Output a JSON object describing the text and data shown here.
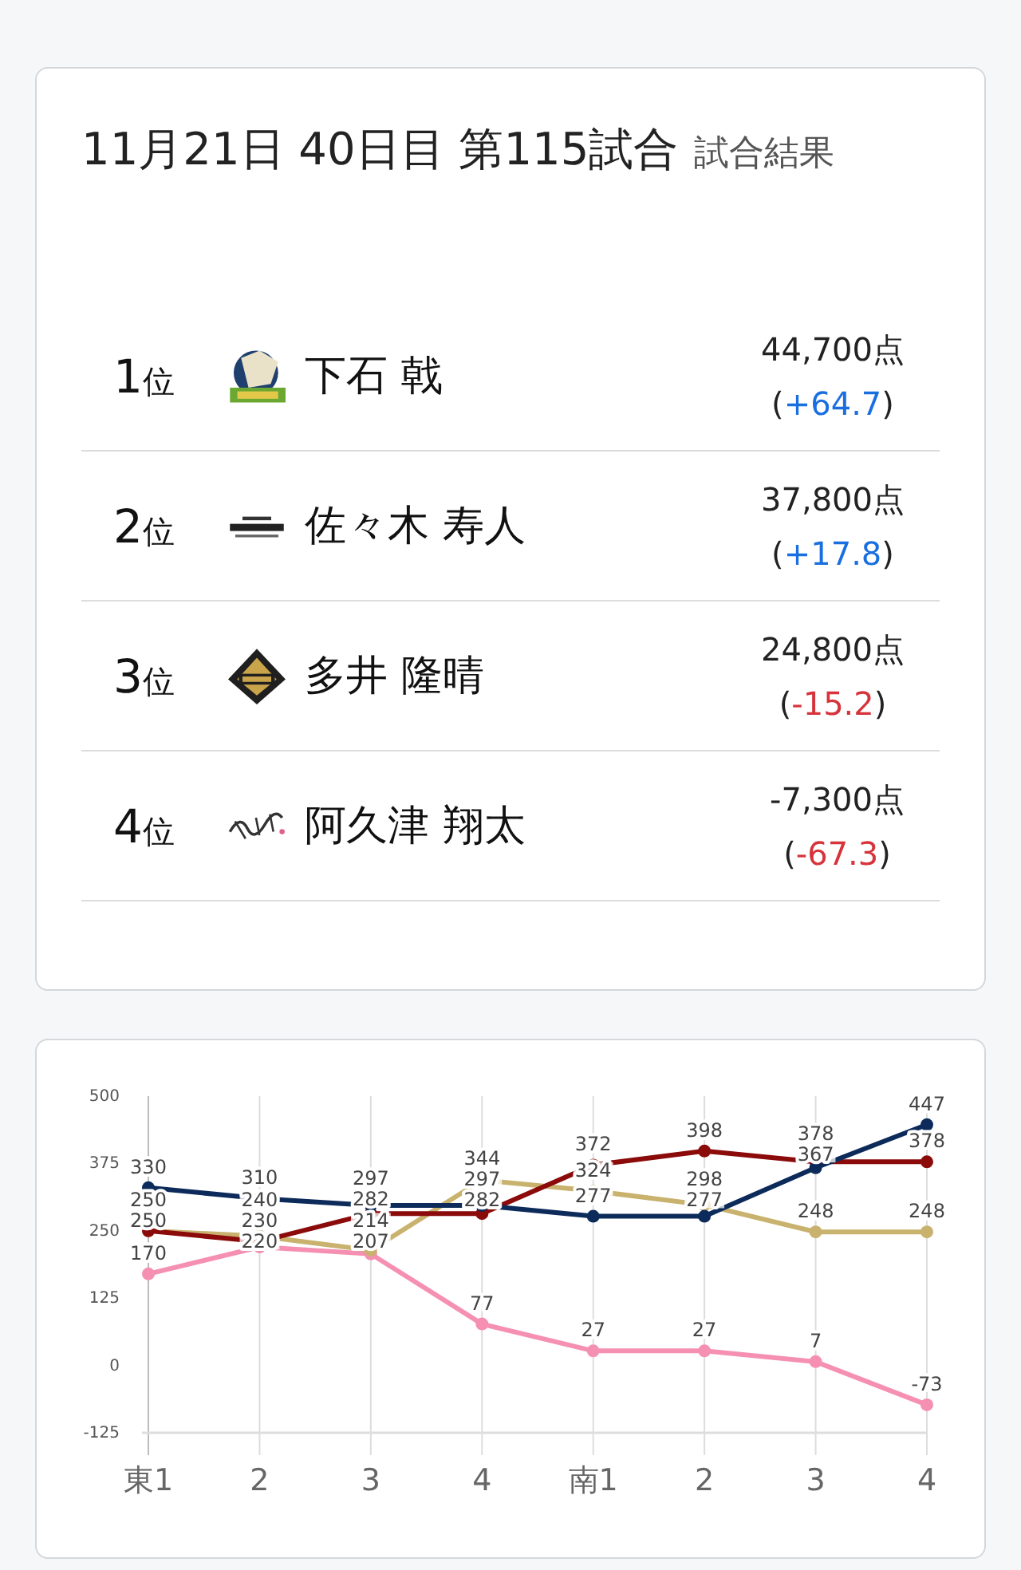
{
  "header": {
    "title": "11月21日 40日目 第115試合",
    "subtitle": "試合結果"
  },
  "results": [
    {
      "rank": "1",
      "rank_suffix": "位",
      "kind": "horse",
      "name": "下石 戟",
      "score": "44,700点",
      "open": "(",
      "delta": "+64.7",
      "close": ")",
      "color": "#1a6fe0"
    },
    {
      "rank": "2",
      "rank_suffix": "位",
      "kind": "wordmark",
      "name": "佐々木 寿人",
      "score": "37,800点",
      "open": "(",
      "delta": "+17.8",
      "close": ")",
      "color": "#1a6fe0"
    },
    {
      "rank": "3",
      "rank_suffix": "位",
      "kind": "crest",
      "name": "多井 隆晴",
      "score": "24,800点",
      "open": "(",
      "delta": "-15.2",
      "close": ")",
      "color": "#d6333b"
    },
    {
      "rank": "4",
      "rank_suffix": "位",
      "kind": "script",
      "name": "阿久津 翔太",
      "score": "-7,300点",
      "open": "(",
      "delta": "-67.3",
      "close": ")",
      "color": "#d6333b"
    }
  ],
  "chart": {
    "chart_data": {
      "type": "line",
      "categories": [
        "東1",
        "2",
        "3",
        "4",
        "南1",
        "2",
        "3",
        "4"
      ],
      "ylim": [
        -125,
        500
      ],
      "yticks": [
        -125,
        0,
        125,
        250,
        375,
        500
      ],
      "grid": true,
      "data_labels": true,
      "series": [
        {
          "color": "#0d2b5a",
          "marker": "circle",
          "values": [
            330,
            310,
            297,
            297,
            277,
            277,
            367,
            447
          ]
        },
        {
          "color": "#8b0a0a",
          "marker": "circle",
          "values": [
            250,
            230,
            282,
            282,
            372,
            398,
            378,
            378
          ]
        },
        {
          "color": "#c8b26e",
          "marker": "circle",
          "values": [
            250,
            240,
            214,
            344,
            324,
            298,
            248,
            248
          ]
        },
        {
          "color": "#f590b2",
          "marker": "circle",
          "values": [
            170,
            220,
            207,
            77,
            27,
            27,
            7,
            -73
          ]
        }
      ]
    }
  }
}
